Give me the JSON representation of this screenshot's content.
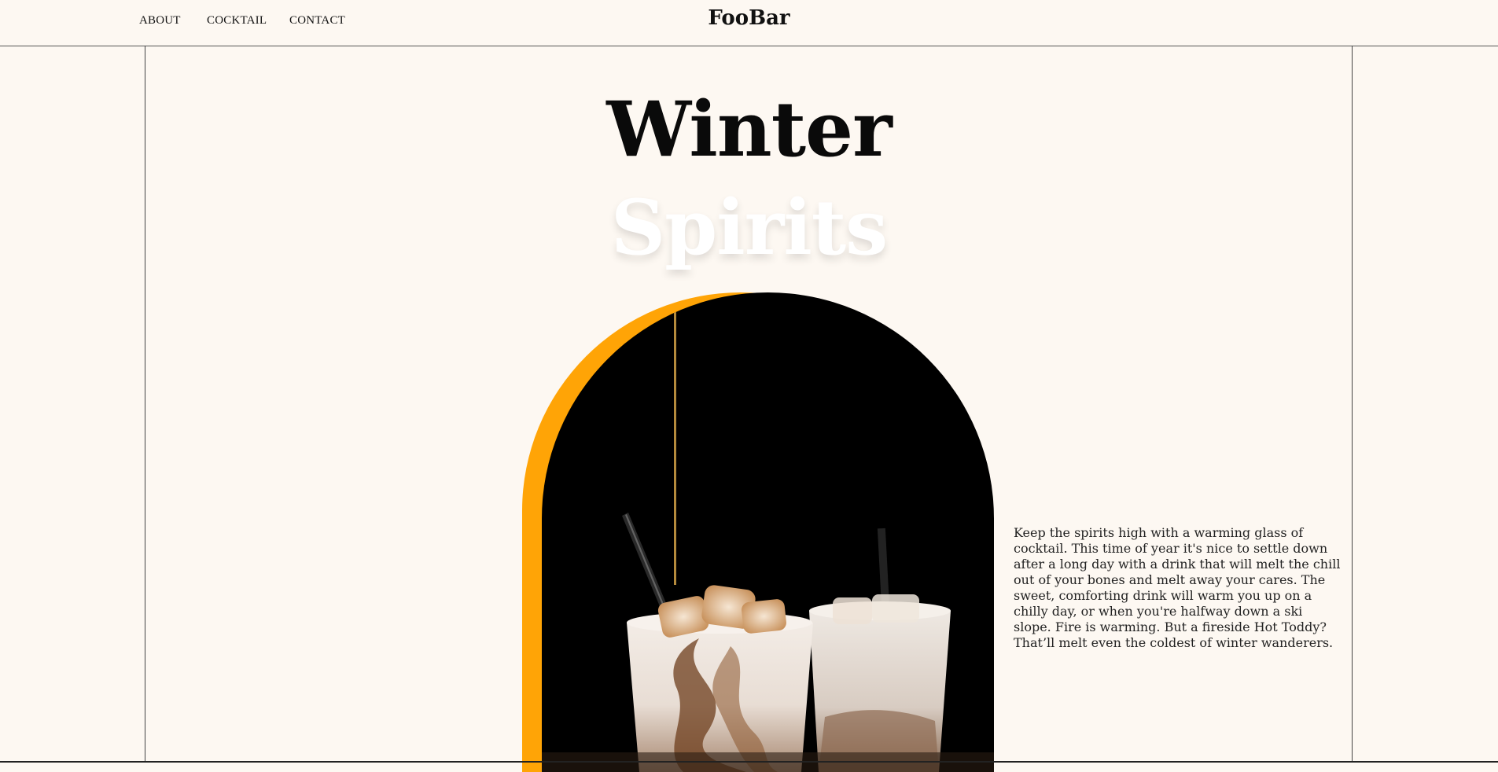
{
  "nav": {
    "links": [
      {
        "label": "ABOUT"
      },
      {
        "label": "COCKTAIL"
      },
      {
        "label": "CONTACT"
      }
    ],
    "brand": "FooBar"
  },
  "hero": {
    "title_line1": "Winter",
    "title_line2": "Spirits",
    "description": "Keep the spirits high with a warming glass of cocktail. This time of year it's nice to settle down after a long day with a drink that will melt the chill out of your bones and melt away your cares. The sweet, comforting drink will warm you up on a chilly day, or when you're halfway down a ski slope. Fire is warming. But a fireside Hot Toddy? That’ll melt even the coldest of winter wanderers."
  },
  "colors": {
    "background": "#fdf8f2",
    "accent": "#ffa406",
    "text": "#111111"
  },
  "image": {
    "subject": "two iced coffee cocktails in glasses with straws on a black background, syrup being poured"
  }
}
